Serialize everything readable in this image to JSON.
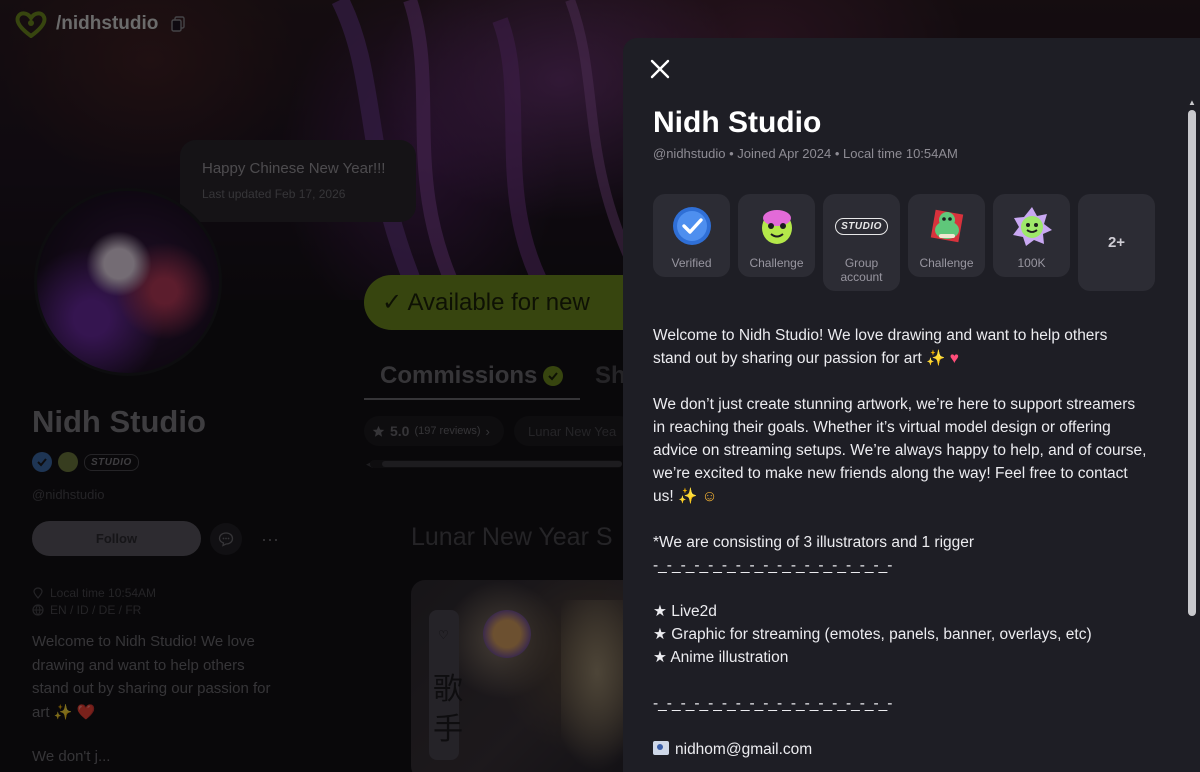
{
  "brand": {
    "handle": "/nidhstudio"
  },
  "status": {
    "text": "Happy Chinese New Year!!!",
    "updated": "Last updated Feb 17, 2026"
  },
  "profile": {
    "name": "Nidh Studio",
    "handle": "@nidhstudio",
    "studio_badge": "STUDIO",
    "follow_label": "Follow",
    "more_label": "···",
    "local_time": "Local time 10:54AM",
    "languages": "EN / ID / DE / FR",
    "bio_lines": [
      "Welcome to Nidh Studio! We love",
      "drawing and want to help others",
      "stand out by sharing our passion for",
      "art ✨ ❤️"
    ],
    "bio_more": "We don't j..."
  },
  "main": {
    "available": "✓ Available for new",
    "tabs": [
      {
        "label": "Commissions"
      },
      {
        "label": "Sh"
      }
    ],
    "rating": {
      "value": "5.0",
      "count": "(197 reviews)",
      "arrow": "›"
    },
    "filter_chip": "Lunar New Yea",
    "section_heading": "Lunar New Year S",
    "preview_kanji": "歌手"
  },
  "modal": {
    "title": "Nidh Studio",
    "subtitle": "@nidhstudio • Joined Apr 2024 • Local time 10:54AM",
    "badges": [
      {
        "label": "Verified",
        "icon": "verified-badge-icon"
      },
      {
        "label": "Challenge",
        "icon": "challenge-badge-icon"
      },
      {
        "label": "Group account",
        "icon": "studio-badge-icon",
        "chip": "STUDIO"
      },
      {
        "label": "Challenge",
        "icon": "snake-challenge-badge-icon"
      },
      {
        "label": "100K",
        "icon": "100k-badge-icon"
      }
    ],
    "more_badges": "2+",
    "bio": {
      "p1_a": "Welcome to Nidh Studio! We love drawing and want to help others",
      "p1_b": "stand out by sharing our passion for art",
      "p2_a": "We don’t just create stunning artwork, we’re here to support streamers",
      "p2_b": "in reaching their goals. Whether it’s virtual model design or offering",
      "p2_c": "advice on streaming setups. We’re always happy to help, and of course,",
      "p2_d": "we’re excited to make new friends along the way! Feel free to contact",
      "p2_e": "us!",
      "p3": "*We are consisting of 3 illustrators and 1 rigger",
      "divider": "-_-_-_-_-_-_-_-_-_-_-_-_-_-_-_-_-_-",
      "services": [
        "★ Live2d",
        "★ Graphic for streaming (emotes, panels, banner, overlays, etc)",
        "★ Anime illustration"
      ],
      "email": "nidhom@gmail.com"
    }
  },
  "colors": {
    "accent_green": "#6e8a1e",
    "modal_bg": "#1e1e25",
    "badge_tile": "#2c2c34",
    "verified_blue": "#3a78d8"
  }
}
